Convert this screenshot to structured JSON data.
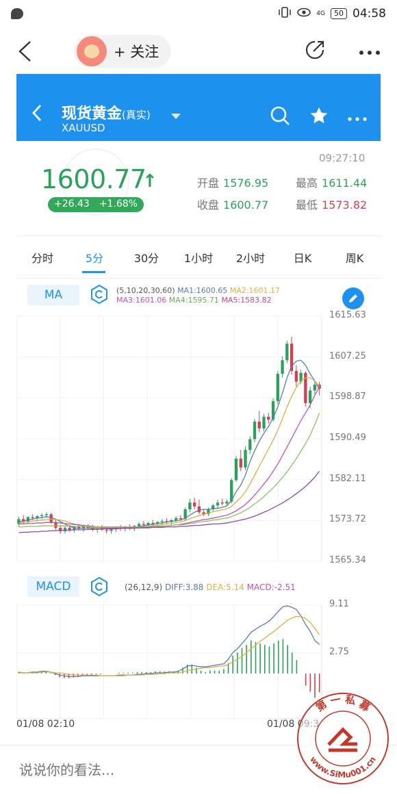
{
  "status_bar": {
    "signal_text": "4G",
    "battery": "50",
    "time": "04:58"
  },
  "post_header": {
    "follow_label": "+ 关注"
  },
  "app": {
    "title": "现货黄金",
    "title_suffix": "(真实)",
    "symbol": "XAUUSD"
  },
  "quote": {
    "time": "09:27:10",
    "price": "1600.77",
    "arrow": "↑",
    "change": "+26.43",
    "change_pct": "+1.68%",
    "open_label": "开盘",
    "open": "1576.95",
    "high_label": "最高",
    "high": "1611.44",
    "close_label": "收盘",
    "close": "1600.77",
    "low_label": "最低",
    "low": "1573.82"
  },
  "tabs": [
    {
      "label": "分时"
    },
    {
      "label": "5分"
    },
    {
      "label": "30分"
    },
    {
      "label": "1小时"
    },
    {
      "label": "2小时"
    },
    {
      "label": "日K"
    },
    {
      "label": "周K"
    }
  ],
  "active_tab": "5分",
  "ma_panel": {
    "label": "MA",
    "params": "(5,10,20,30,60)",
    "ma1": "MA1:1600.65",
    "ma2": "MA2:1601.17",
    "ma3": "MA3:1601.06",
    "ma4": "MA4:1595.71",
    "ma5": "MA5:1583.82",
    "yticks": [
      "1615.63",
      "1607.25",
      "1598.87",
      "1590.49",
      "1582.11",
      "1573.72",
      "1565.34"
    ]
  },
  "macd_panel": {
    "label": "MACD",
    "params": "(26,12,9)",
    "diff": "DIFF:3.88",
    "dea": "DEA:5.14",
    "macd": "MACD:-2.51",
    "yticks": [
      "9.11",
      "2.75"
    ]
  },
  "x_labels": [
    "01/08 02:10",
    "01/08 09:3"
  ],
  "comment_placeholder": "说说你的看法...",
  "watermark": {
    "top_text": "第 一 私 募",
    "url_text": "www.SiMu001.cn"
  },
  "colors": {
    "accent": "#1e90ee",
    "up": "#2ca05a",
    "down": "#d04050",
    "ma1": "#5a7ab0",
    "ma2": "#d8b040",
    "ma3": "#c050b0",
    "ma4": "#8cc060",
    "ma5": "#8a4aaa"
  },
  "chart_data": [
    {
      "type": "candlestick",
      "title": "",
      "ylim": [
        1565.34,
        1615.63
      ],
      "yticks": [
        1615.63,
        1607.25,
        1598.87,
        1590.49,
        1582.11,
        1573.72,
        1565.34
      ],
      "candles": [
        [
          1573.0,
          1574.5,
          1572.5,
          1574.0
        ],
        [
          1574.0,
          1574.8,
          1573.0,
          1573.5
        ],
        [
          1573.5,
          1574.6,
          1573.0,
          1574.4
        ],
        [
          1574.4,
          1575.0,
          1573.8,
          1574.2
        ],
        [
          1574.2,
          1574.8,
          1573.5,
          1574.6
        ],
        [
          1574.6,
          1575.2,
          1574.0,
          1574.8
        ],
        [
          1574.8,
          1575.4,
          1574.2,
          1575.0
        ],
        [
          1575.0,
          1575.3,
          1573.0,
          1573.4
        ],
        [
          1573.4,
          1574.0,
          1571.8,
          1572.2
        ],
        [
          1572.2,
          1572.8,
          1571.0,
          1571.5
        ],
        [
          1571.5,
          1572.6,
          1571.0,
          1572.2
        ],
        [
          1572.2,
          1572.8,
          1571.4,
          1571.8
        ],
        [
          1571.8,
          1572.6,
          1571.2,
          1572.4
        ],
        [
          1572.4,
          1573.0,
          1571.8,
          1572.0
        ],
        [
          1572.0,
          1572.8,
          1571.4,
          1572.6
        ],
        [
          1572.6,
          1573.0,
          1571.8,
          1572.2
        ],
        [
          1572.2,
          1572.8,
          1571.5,
          1571.9
        ],
        [
          1571.9,
          1572.6,
          1571.2,
          1572.3
        ],
        [
          1572.3,
          1572.8,
          1571.6,
          1571.8
        ],
        [
          1571.8,
          1572.4,
          1571.0,
          1571.6
        ],
        [
          1571.6,
          1572.2,
          1571.0,
          1571.9
        ],
        [
          1571.9,
          1572.5,
          1571.3,
          1572.2
        ],
        [
          1572.2,
          1572.8,
          1571.6,
          1572.0
        ],
        [
          1572.0,
          1572.6,
          1571.4,
          1572.4
        ],
        [
          1572.4,
          1573.0,
          1571.8,
          1572.2
        ],
        [
          1572.2,
          1572.8,
          1571.5,
          1572.6
        ],
        [
          1572.6,
          1573.4,
          1572.0,
          1573.0
        ],
        [
          1573.0,
          1573.6,
          1572.4,
          1572.8
        ],
        [
          1572.8,
          1573.4,
          1572.2,
          1573.2
        ],
        [
          1573.2,
          1573.8,
          1572.6,
          1573.0
        ],
        [
          1573.0,
          1573.6,
          1572.4,
          1573.4
        ],
        [
          1573.4,
          1574.0,
          1572.8,
          1573.6
        ],
        [
          1573.6,
          1574.2,
          1573.0,
          1573.4
        ],
        [
          1573.4,
          1574.0,
          1572.8,
          1573.8
        ],
        [
          1573.8,
          1574.6,
          1573.2,
          1574.2
        ],
        [
          1574.2,
          1574.8,
          1573.6,
          1574.0
        ],
        [
          1574.0,
          1576.4,
          1573.6,
          1576.0
        ],
        [
          1576.0,
          1578.2,
          1575.4,
          1577.4
        ],
        [
          1577.4,
          1578.4,
          1576.0,
          1576.6
        ],
        [
          1576.6,
          1578.0,
          1575.0,
          1575.4
        ],
        [
          1575.4,
          1576.0,
          1574.6,
          1575.0
        ],
        [
          1575.0,
          1576.4,
          1574.6,
          1576.0
        ],
        [
          1576.0,
          1577.2,
          1575.6,
          1576.8
        ],
        [
          1576.8,
          1578.0,
          1576.2,
          1577.4
        ],
        [
          1577.4,
          1578.2,
          1576.8,
          1577.2
        ],
        [
          1577.2,
          1578.0,
          1576.8,
          1577.6
        ],
        [
          1577.6,
          1582.4,
          1577.2,
          1582.0
        ],
        [
          1582.0,
          1587.0,
          1581.6,
          1586.4
        ],
        [
          1586.4,
          1588.2,
          1583.8,
          1584.6
        ],
        [
          1584.6,
          1589.0,
          1584.0,
          1588.2
        ],
        [
          1588.2,
          1591.0,
          1587.4,
          1590.4
        ],
        [
          1590.4,
          1594.6,
          1589.8,
          1594.0
        ],
        [
          1594.0,
          1596.2,
          1591.8,
          1592.6
        ],
        [
          1592.6,
          1595.6,
          1592.0,
          1595.0
        ],
        [
          1595.0,
          1595.8,
          1593.6,
          1594.4
        ],
        [
          1594.4,
          1598.8,
          1594.0,
          1598.2
        ],
        [
          1598.2,
          1604.4,
          1597.6,
          1603.8
        ],
        [
          1603.8,
          1607.4,
          1603.0,
          1606.6
        ],
        [
          1606.6,
          1610.6,
          1606.0,
          1610.0
        ],
        [
          1610.0,
          1611.44,
          1603.6,
          1604.4
        ],
        [
          1604.4,
          1605.6,
          1601.2,
          1602.2
        ],
        [
          1602.2,
          1604.6,
          1601.6,
          1604.0
        ],
        [
          1604.0,
          1604.4,
          1597.0,
          1597.8
        ],
        [
          1597.8,
          1601.2,
          1596.8,
          1600.4
        ],
        [
          1600.4,
          1602.4,
          1599.6,
          1601.6
        ],
        [
          1601.6,
          1602.2,
          1599.4,
          1600.77
        ]
      ],
      "series": [
        {
          "name": "MA1",
          "values": [
            1573.4,
            1573.6,
            1573.8,
            1574.0,
            1574.2,
            1574.3,
            1574.5,
            1574.3,
            1574.0,
            1573.5,
            1573.0,
            1572.5,
            1572.2,
            1572.1,
            1572.1,
            1572.2,
            1572.1,
            1572.2,
            1572.1,
            1572.0,
            1572.0,
            1572.0,
            1572.1,
            1572.1,
            1572.2,
            1572.3,
            1572.5,
            1572.6,
            1572.8,
            1572.9,
            1573.1,
            1573.2,
            1573.4,
            1573.5,
            1573.7,
            1573.8,
            1574.2,
            1574.8,
            1575.4,
            1575.8,
            1576.0,
            1576.0,
            1576.1,
            1576.2,
            1576.4,
            1576.7,
            1577.8,
            1579.6,
            1581.0,
            1583.0,
            1585.8,
            1588.0,
            1590.0,
            1591.6,
            1593.0,
            1594.8,
            1597.0,
            1599.8,
            1603.0,
            1605.4,
            1606.4,
            1606.6,
            1605.6,
            1603.8,
            1602.4,
            1600.65
          ]
        },
        {
          "name": "MA2",
          "values": [
            1573.2,
            1573.3,
            1573.4,
            1573.6,
            1573.7,
            1573.8,
            1573.9,
            1574.0,
            1573.9,
            1573.8,
            1573.6,
            1573.3,
            1573.0,
            1572.8,
            1572.6,
            1572.4,
            1572.3,
            1572.2,
            1572.2,
            1572.1,
            1572.1,
            1572.1,
            1572.1,
            1572.1,
            1572.1,
            1572.2,
            1572.3,
            1572.4,
            1572.5,
            1572.6,
            1572.7,
            1572.9,
            1573.0,
            1573.1,
            1573.3,
            1573.4,
            1573.7,
            1574.1,
            1574.4,
            1574.7,
            1575.0,
            1575.2,
            1575.5,
            1575.7,
            1575.9,
            1576.1,
            1576.6,
            1577.5,
            1578.4,
            1579.6,
            1581.2,
            1583.0,
            1584.8,
            1586.6,
            1588.4,
            1590.2,
            1592.2,
            1594.6,
            1597.0,
            1599.2,
            1601.0,
            1602.4,
            1603.0,
            1603.0,
            1602.4,
            1601.17
          ]
        },
        {
          "name": "MA3",
          "values": [
            1573.0,
            1573.0,
            1573.1,
            1573.1,
            1573.2,
            1573.2,
            1573.3,
            1573.3,
            1573.3,
            1573.2,
            1573.1,
            1573.0,
            1572.9,
            1572.8,
            1572.7,
            1572.6,
            1572.5,
            1572.4,
            1572.3,
            1572.2,
            1572.2,
            1572.2,
            1572.2,
            1572.2,
            1572.2,
            1572.2,
            1572.2,
            1572.3,
            1572.3,
            1572.4,
            1572.4,
            1572.5,
            1572.6,
            1572.7,
            1572.8,
            1572.9,
            1573.1,
            1573.3,
            1573.5,
            1573.7,
            1573.9,
            1574.0,
            1574.2,
            1574.4,
            1574.6,
            1574.8,
            1575.2,
            1575.7,
            1576.3,
            1577.0,
            1577.9,
            1578.9,
            1580.0,
            1581.2,
            1582.4,
            1583.8,
            1585.3,
            1587.0,
            1588.8,
            1590.6,
            1592.4,
            1594.2,
            1595.8,
            1597.4,
            1599.4,
            1601.06
          ]
        },
        {
          "name": "MA4",
          "values": [
            1572.4,
            1572.4,
            1572.5,
            1572.5,
            1572.5,
            1572.6,
            1572.6,
            1572.6,
            1572.6,
            1572.6,
            1572.6,
            1572.6,
            1572.5,
            1572.5,
            1572.5,
            1572.5,
            1572.4,
            1572.4,
            1572.4,
            1572.4,
            1572.4,
            1572.4,
            1572.4,
            1572.4,
            1572.4,
            1572.4,
            1572.4,
            1572.4,
            1572.5,
            1572.5,
            1572.5,
            1572.6,
            1572.6,
            1572.7,
            1572.8,
            1572.8,
            1572.9,
            1573.1,
            1573.2,
            1573.4,
            1573.5,
            1573.6,
            1573.8,
            1573.9,
            1574.1,
            1574.2,
            1574.5,
            1574.9,
            1575.3,
            1575.8,
            1576.4,
            1577.1,
            1577.8,
            1578.6,
            1579.5,
            1580.4,
            1581.4,
            1582.5,
            1583.7,
            1585.0,
            1586.4,
            1587.9,
            1589.5,
            1591.2,
            1593.4,
            1595.71
          ]
        },
        {
          "name": "MA5",
          "values": [
            1571.2,
            1571.3,
            1571.3,
            1571.4,
            1571.4,
            1571.5,
            1571.5,
            1571.6,
            1571.6,
            1571.7,
            1571.7,
            1571.7,
            1571.8,
            1571.8,
            1571.8,
            1571.9,
            1571.9,
            1571.9,
            1572.0,
            1572.0,
            1572.0,
            1572.0,
            1572.1,
            1572.1,
            1572.1,
            1572.1,
            1572.2,
            1572.2,
            1572.2,
            1572.3,
            1572.3,
            1572.3,
            1572.4,
            1572.4,
            1572.4,
            1572.5,
            1572.5,
            1572.6,
            1572.7,
            1572.7,
            1572.8,
            1572.9,
            1573.0,
            1573.0,
            1573.1,
            1573.2,
            1573.4,
            1573.6,
            1573.8,
            1574.0,
            1574.3,
            1574.6,
            1575.0,
            1575.4,
            1575.8,
            1576.3,
            1576.8,
            1577.3,
            1577.9,
            1578.5,
            1579.2,
            1579.9,
            1580.7,
            1581.6,
            1582.6,
            1583.82
          ]
        }
      ]
    },
    {
      "type": "bar",
      "title": "",
      "ylim": [
        -6,
        9.11
      ],
      "yticks": [
        9.11,
        2.75
      ],
      "series": [
        {
          "name": "DIFF",
          "values": [
            0.2,
            0.1,
            0.1,
            0.2,
            0.2,
            0.3,
            0.3,
            0.2,
            0.0,
            -0.2,
            -0.3,
            -0.4,
            -0.4,
            -0.4,
            -0.3,
            -0.3,
            -0.3,
            -0.3,
            -0.3,
            -0.3,
            -0.3,
            -0.3,
            -0.2,
            -0.2,
            -0.2,
            -0.2,
            -0.1,
            -0.1,
            0.0,
            0.0,
            0.1,
            0.1,
            0.1,
            0.2,
            0.2,
            0.3,
            0.6,
            1.0,
            1.1,
            1.0,
            0.9,
            0.9,
            1.0,
            1.1,
            1.2,
            1.3,
            1.9,
            2.8,
            3.3,
            4.0,
            4.7,
            5.5,
            5.9,
            6.3,
            6.6,
            7.0,
            7.6,
            8.3,
            8.9,
            9.0,
            8.8,
            8.5,
            7.6,
            6.5,
            5.6,
            4.4,
            3.88
          ]
        },
        {
          "name": "DEA",
          "values": [
            0.1,
            0.1,
            0.1,
            0.1,
            0.1,
            0.2,
            0.2,
            0.2,
            0.1,
            0.1,
            0.0,
            -0.1,
            -0.2,
            -0.2,
            -0.2,
            -0.2,
            -0.2,
            -0.2,
            -0.3,
            -0.3,
            -0.3,
            -0.3,
            -0.3,
            -0.3,
            -0.2,
            -0.2,
            -0.2,
            -0.2,
            -0.1,
            -0.1,
            -0.1,
            0.0,
            0.0,
            0.1,
            0.1,
            0.1,
            0.2,
            0.4,
            0.5,
            0.6,
            0.7,
            0.8,
            0.8,
            0.9,
            1.0,
            1.0,
            1.2,
            1.6,
            1.9,
            2.3,
            2.8,
            3.3,
            3.8,
            4.3,
            4.7,
            5.2,
            5.6,
            6.1,
            6.6,
            7.1,
            7.4,
            7.6,
            7.6,
            7.3,
            6.8,
            6.0,
            5.14
          ]
        },
        {
          "name": "MACD",
          "values": [
            0.2,
            0.1,
            0.1,
            0.2,
            0.2,
            0.2,
            0.2,
            0.1,
            -0.2,
            -0.5,
            -0.6,
            -0.6,
            -0.5,
            -0.4,
            -0.3,
            -0.2,
            -0.2,
            -0.1,
            -0.1,
            0.0,
            0.0,
            0.0,
            0.1,
            0.1,
            0.1,
            0.1,
            0.2,
            0.2,
            0.2,
            0.2,
            0.3,
            0.3,
            0.3,
            0.3,
            0.3,
            0.4,
            0.8,
            1.2,
            1.2,
            0.8,
            0.4,
            0.2,
            0.4,
            0.4,
            0.4,
            0.6,
            1.4,
            2.4,
            2.8,
            3.4,
            3.8,
            4.4,
            4.2,
            4.0,
            3.8,
            3.6,
            4.0,
            4.4,
            4.6,
            3.8,
            2.8,
            1.8,
            0.0,
            -1.6,
            -2.4,
            -3.2,
            -2.51
          ]
        }
      ]
    }
  ]
}
